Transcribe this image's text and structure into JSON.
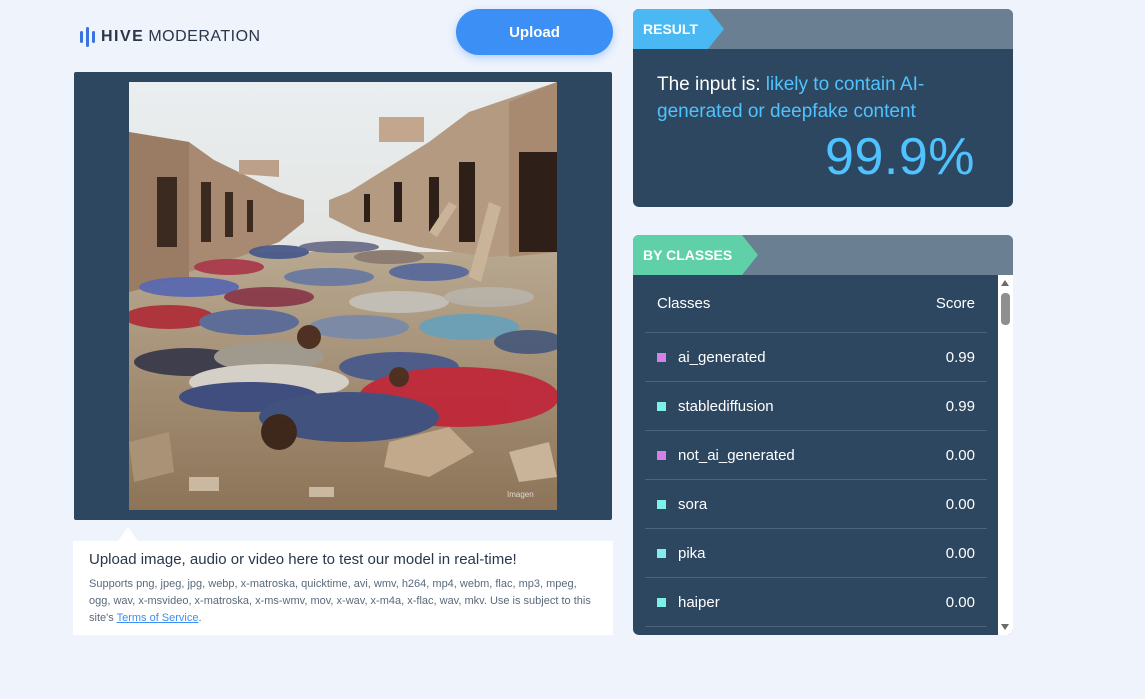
{
  "brand": {
    "name_bold": "HIVE",
    "name_rest": "MODERATION",
    "accent": "#3a72e0"
  },
  "upload_button": {
    "label": "Upload",
    "color": "#3b8ff5"
  },
  "preview": {
    "watermark": "Imagen"
  },
  "info": {
    "title": "Upload image, audio or video here to test our model in real-time!",
    "supports_text": "Supports png, jpeg, jpg, webp, x-matroska, quicktime, avi, wmv, h264, mp4, webm, flac, mp3, mpeg, ogg, wav, x-msvideo, x-matroska, x-ms-wmv, mov, x-wav, x-m4a, x-flac, wav, mkv. Use is subject to this site's ",
    "terms_link": "Terms of Service",
    "terms_suffix": "."
  },
  "result": {
    "tag": "RESULT",
    "prefix": "The input is: ",
    "verdict": "likely to contain AI-generated or deepfake content",
    "score": "99.9%",
    "tag_color": "#4ab8f2",
    "score_color": "#4fc3ff"
  },
  "classes": {
    "tag": "BY CLASSES",
    "tag_color": "#5fd0a8",
    "header_class": "Classes",
    "header_score": "Score",
    "rows": [
      {
        "name": "ai_generated",
        "score": "0.99",
        "color": "#d67fe8"
      },
      {
        "name": "stablediffusion",
        "score": "0.99",
        "color": "#7ff0e8"
      },
      {
        "name": "not_ai_generated",
        "score": "0.00",
        "color": "#d67fe8"
      },
      {
        "name": "sora",
        "score": "0.00",
        "color": "#7ff0e8"
      },
      {
        "name": "pika",
        "score": "0.00",
        "color": "#7ff0e8"
      },
      {
        "name": "haiper",
        "score": "0.00",
        "color": "#7ff0e8"
      }
    ]
  }
}
